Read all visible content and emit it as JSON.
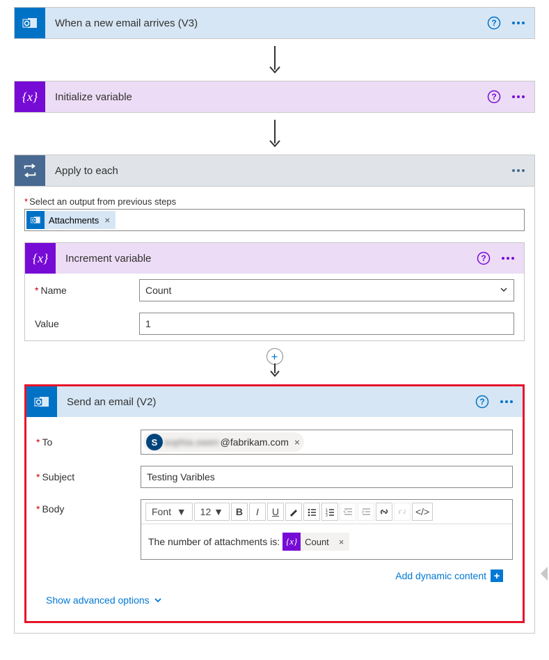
{
  "step1": {
    "title": "When a new email arrives (V3)"
  },
  "step2": {
    "title": "Initialize variable"
  },
  "step3": {
    "title": "Apply to each",
    "select_label": "Select an output from previous steps",
    "token": "Attachments"
  },
  "step4": {
    "title": "Increment variable",
    "name_label": "Name",
    "name_value": "Count",
    "value_label": "Value",
    "value_value": "1"
  },
  "step5": {
    "title": "Send an email (V2)",
    "to_label": "To",
    "avatar_initial": "S",
    "email_hidden": "sophia.owen",
    "email_domain": "@fabrikam.com",
    "subject_label": "Subject",
    "subject_value": "Testing Varibles",
    "body_label": "Body",
    "font_label": "Font",
    "font_size": "12",
    "body_text": "The number of attachments is:",
    "body_token": "Count",
    "dynamic_link": "Add dynamic content",
    "advanced_link": "Show advanced options"
  }
}
